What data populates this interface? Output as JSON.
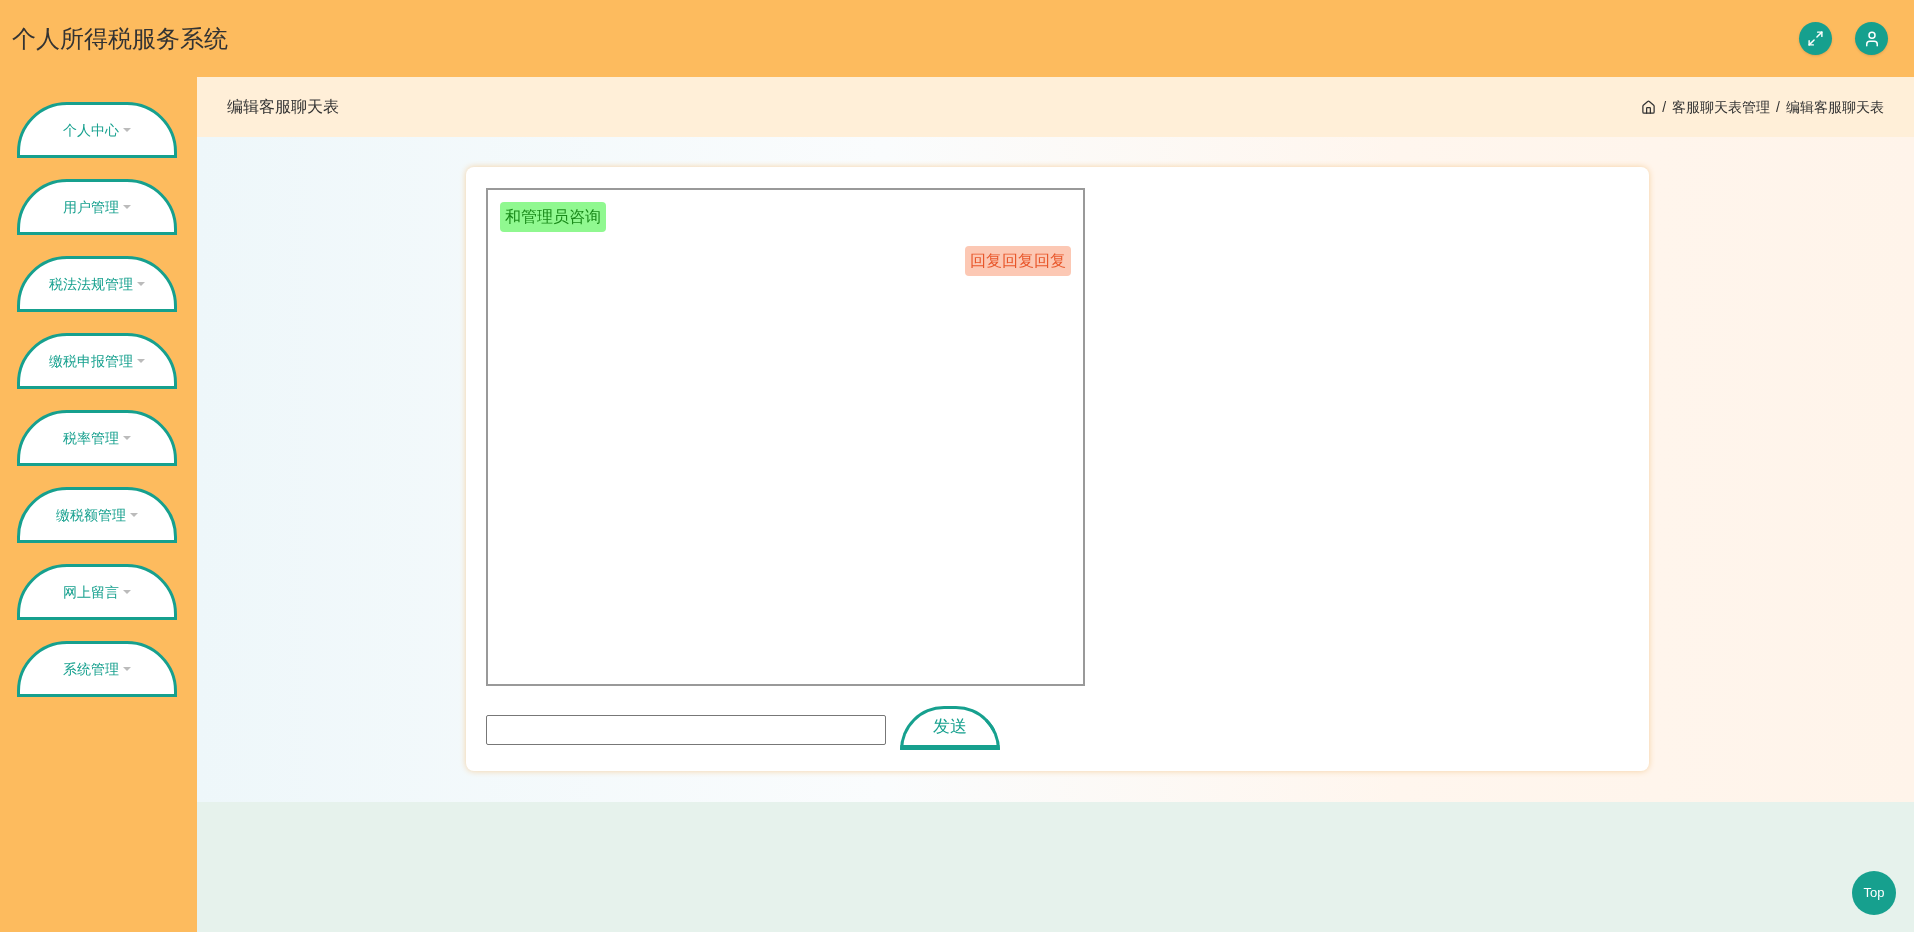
{
  "header": {
    "title": "个人所得税服务系统"
  },
  "sidebar": {
    "items": [
      {
        "label": "个人中心"
      },
      {
        "label": "用户管理"
      },
      {
        "label": "税法法规管理"
      },
      {
        "label": "缴税申报管理"
      },
      {
        "label": "税率管理"
      },
      {
        "label": "缴税额管理"
      },
      {
        "label": "网上留言"
      },
      {
        "label": "系统管理"
      }
    ]
  },
  "page_title": "编辑客服聊天表",
  "breadcrumb": [
    {
      "separator": "/",
      "label": "客服聊天表管理"
    },
    {
      "separator": "/",
      "label": "编辑客服聊天表"
    }
  ],
  "chat": {
    "messages": [
      {
        "kind": "user",
        "text": "和管理员咨询"
      },
      {
        "kind": "reply",
        "text": "回复回复回复"
      }
    ]
  },
  "send_button": "发送",
  "top_button": "Top"
}
